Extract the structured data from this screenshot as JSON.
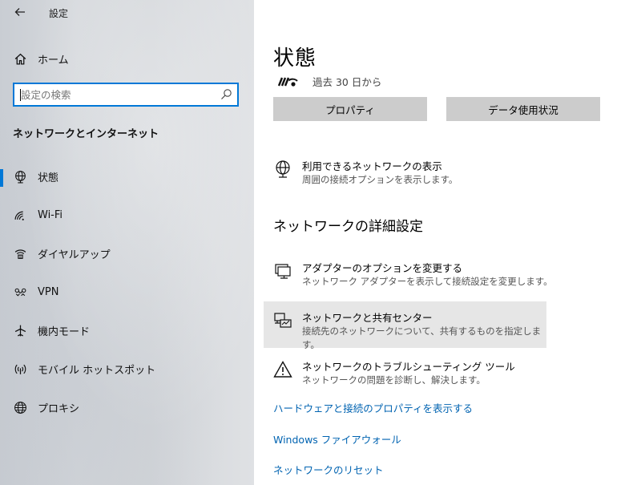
{
  "app": {
    "title": "設定",
    "back_icon": "back-arrow-icon"
  },
  "sidebar": {
    "home_label": "ホーム",
    "search": {
      "placeholder": "設定の検索",
      "value": ""
    },
    "section_title": "ネットワークとインターネット",
    "items": [
      {
        "label": "状態",
        "icon": "globe-network-icon",
        "selected": true
      },
      {
        "label": "Wi-Fi",
        "icon": "wifi-icon",
        "selected": false
      },
      {
        "label": "ダイヤルアップ",
        "icon": "dialup-icon",
        "selected": false
      },
      {
        "label": "VPN",
        "icon": "vpn-icon",
        "selected": false
      },
      {
        "label": "機内モード",
        "icon": "airplane-icon",
        "selected": false
      },
      {
        "label": "モバイル ホットスポット",
        "icon": "hotspot-icon",
        "selected": false
      },
      {
        "label": "プロキシ",
        "icon": "globe-icon",
        "selected": false
      }
    ]
  },
  "main": {
    "title": "状態",
    "status_text": "過去 30 日から",
    "buttons": {
      "properties": "プロパティ",
      "data_usage": "データ使用状況"
    },
    "available_networks": {
      "title": "利用できるネットワークの表示",
      "desc": "周囲の接続オプションを表示します。"
    },
    "advanced_heading": "ネットワークの詳細設定",
    "options": [
      {
        "title": "アダプターのオプションを変更する",
        "desc": "ネットワーク アダプターを表示して接続設定を変更します。"
      },
      {
        "title": "ネットワークと共有センター",
        "desc": "接続先のネットワークについて、共有するものを指定します。"
      },
      {
        "title": "ネットワークのトラブルシューティング ツール",
        "desc": "ネットワークの問題を診断し、解決します。"
      }
    ],
    "links": {
      "hardware": "ハードウェアと接続のプロパティを表示する",
      "firewall": "Windows ファイアウォール",
      "reset": "ネットワークのリセット"
    }
  },
  "colors": {
    "accent": "#0078d7",
    "link": "#0063b1",
    "button": "#cccccc",
    "hover": "#e6e6e6"
  }
}
